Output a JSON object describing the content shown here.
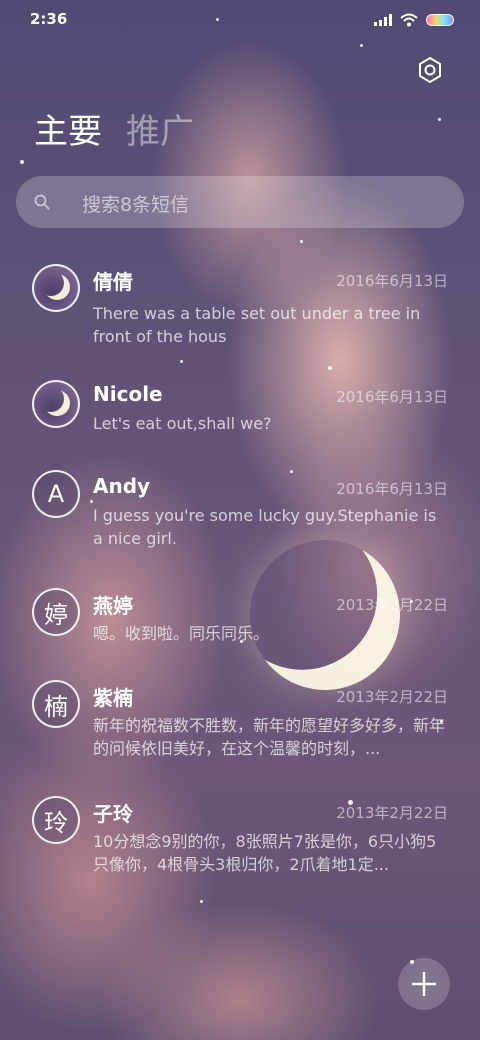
{
  "status_bar": {
    "time": "2:36"
  },
  "tabs": [
    {
      "label": "主要",
      "active": true
    },
    {
      "label": "推广",
      "active": false
    }
  ],
  "search": {
    "placeholder": "搜索8条短信"
  },
  "conversations": [
    {
      "name": "倩倩",
      "date": "2016年6月13日",
      "preview": "There was a table set out under a tree in front of the hous",
      "avatar": {
        "type": "image",
        "icon": "moon-avatar-icon"
      }
    },
    {
      "name": "Nicole",
      "date": "2016年6月13日",
      "preview": "Let's eat out,shall we?",
      "avatar": {
        "type": "image",
        "icon": "moon-avatar-icon"
      }
    },
    {
      "name": "Andy",
      "date": "2016年6月13日",
      "preview": "I guess you're some lucky guy.Stephanie is a nice girl.",
      "avatar": {
        "type": "letter",
        "text": "A"
      }
    },
    {
      "name": "燕婷",
      "date": "2013年2月22日",
      "preview": "嗯。收到啦。同乐同乐。",
      "avatar": {
        "type": "letter",
        "text": "婷"
      }
    },
    {
      "name": "紫楠",
      "date": "2013年2月22日",
      "preview": "新年的祝福数不胜数，新年的愿望好多好多，新年的问候依旧美好，在这个温馨的时刻，...",
      "avatar": {
        "type": "letter",
        "text": "楠"
      }
    },
    {
      "name": "子玲",
      "date": "2013年2月22日",
      "preview": "10分想念9别的你，8张照片7张是你，6只小狗5只像你，4根骨头3根归你，2爪着地1定...",
      "avatar": {
        "type": "letter",
        "text": "玲"
      }
    }
  ],
  "icons": {
    "settings": "gear-icon",
    "search": "search-icon",
    "compose": "plus-icon"
  },
  "colors": {
    "background_top": "#524a73",
    "background_bottom": "#5d4f71",
    "text_primary": "#ffffff"
  }
}
